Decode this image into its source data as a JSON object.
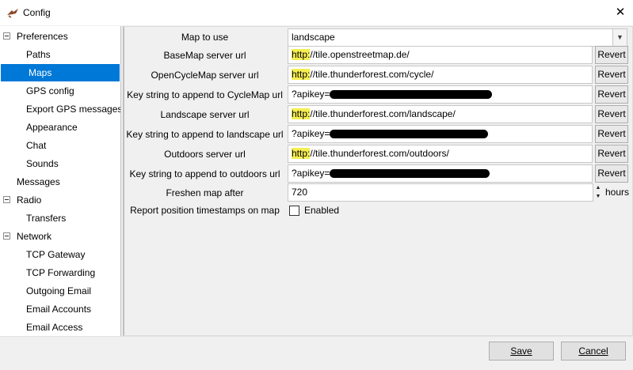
{
  "window": {
    "title": "Config",
    "app_icon": "gps-app-icon",
    "close_icon": "close-icon"
  },
  "sidebar": {
    "items": [
      {
        "label": "Preferences",
        "level": 0,
        "expanded": true
      },
      {
        "label": "Paths",
        "level": 1
      },
      {
        "label": "Maps",
        "level": 1,
        "selected": true
      },
      {
        "label": "GPS config",
        "level": 1
      },
      {
        "label": "Export GPS messages",
        "level": 1
      },
      {
        "label": "Appearance",
        "level": 1
      },
      {
        "label": "Chat",
        "level": 1
      },
      {
        "label": "Sounds",
        "level": 1
      },
      {
        "label": "Messages",
        "level": 0
      },
      {
        "label": "Radio",
        "level": 0,
        "expanded": true
      },
      {
        "label": "Transfers",
        "level": 1
      },
      {
        "label": "Network",
        "level": 0,
        "expanded": true
      },
      {
        "label": "TCP Gateway",
        "level": 1
      },
      {
        "label": "TCP Forwarding",
        "level": 1
      },
      {
        "label": "Outgoing Email",
        "level": 1
      },
      {
        "label": "Email Accounts",
        "level": 1
      },
      {
        "label": "Email Access",
        "level": 1
      }
    ]
  },
  "settings": {
    "map_to_use": {
      "label": "Map to use",
      "value": "landscape"
    },
    "basemap_url": {
      "label": "BaseMap server url",
      "scheme": "http:",
      "rest": "//tile.openstreetmap.de/"
    },
    "opencyclemap_url": {
      "label": "OpenCycleMap server url",
      "scheme": "http:",
      "rest": "//tile.thunderforest.com/cycle/"
    },
    "cyclemap_key": {
      "label": "Key string to append to CycleMap url",
      "prefix": "?apikey="
    },
    "landscape_url": {
      "label": "Landscape server url",
      "scheme": "http:",
      "rest": "//tile.thunderforest.com/landscape/"
    },
    "landscape_key": {
      "label": "Key string to append to landscape url",
      "prefix": "?apikey="
    },
    "outdoors_url": {
      "label": "Outdoors server url",
      "scheme": "http:",
      "rest": "//tile.thunderforest.com/outdoors/"
    },
    "outdoors_key": {
      "label": "Key string to append to outdoors url",
      "prefix": "?apikey="
    },
    "freshen": {
      "label": "Freshen map after",
      "value": "720",
      "unit": "hours"
    },
    "report_timestamps": {
      "label": "Report position timestamps on map",
      "checkbox_label": "Enabled",
      "checked": false
    },
    "revert_label": "Revert"
  },
  "buttons": {
    "save": "Save",
    "cancel": "Cancel"
  }
}
